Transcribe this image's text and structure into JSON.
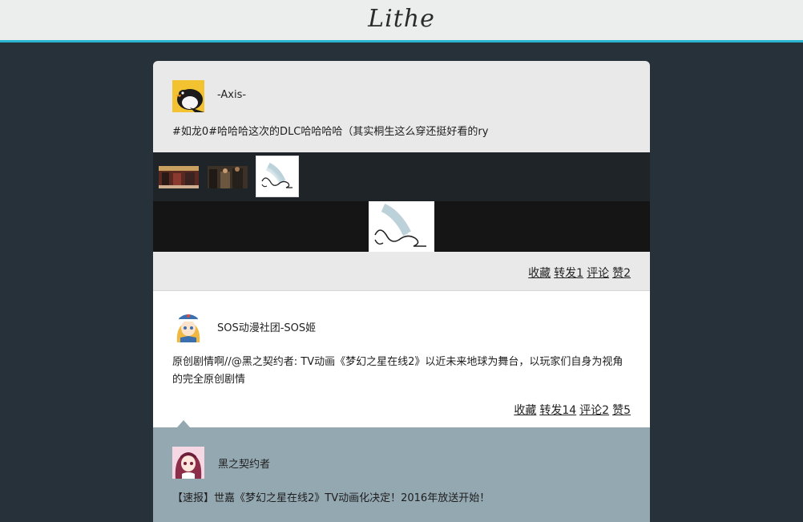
{
  "app": {
    "brand": "Lithe"
  },
  "posts": [
    {
      "username": "-Axis-",
      "text": "#如龙0#哈哈哈这次的DLC哈哈哈哈（其实桐生这么穿还挺好看的ry",
      "actions": {
        "favorite": "收藏",
        "repost": "转发1",
        "comment": "评论",
        "like": "赞2"
      }
    },
    {
      "username": "SOS动漫社团-SOS姬",
      "text": "原创剧情啊//@黑之契约者: TV动画《梦幻之星在线2》以近未来地球为舞台，以玩家们自身为视角的完全原创剧情",
      "actions": {
        "favorite": "收藏",
        "repost": "转发14",
        "comment": "评论2",
        "like": "赞5"
      },
      "quoted": {
        "username": "黑之契约者",
        "text": "【速报】世嘉《梦幻之星在线2》TV动画化决定！2016年放送开始！"
      }
    }
  ],
  "colors": {
    "accent": "#2ab4d2",
    "page_bg": "#27313a",
    "header_bg": "#eceded",
    "card_bg": "#e9e9e9",
    "quote_bg": "#94a8b2"
  }
}
